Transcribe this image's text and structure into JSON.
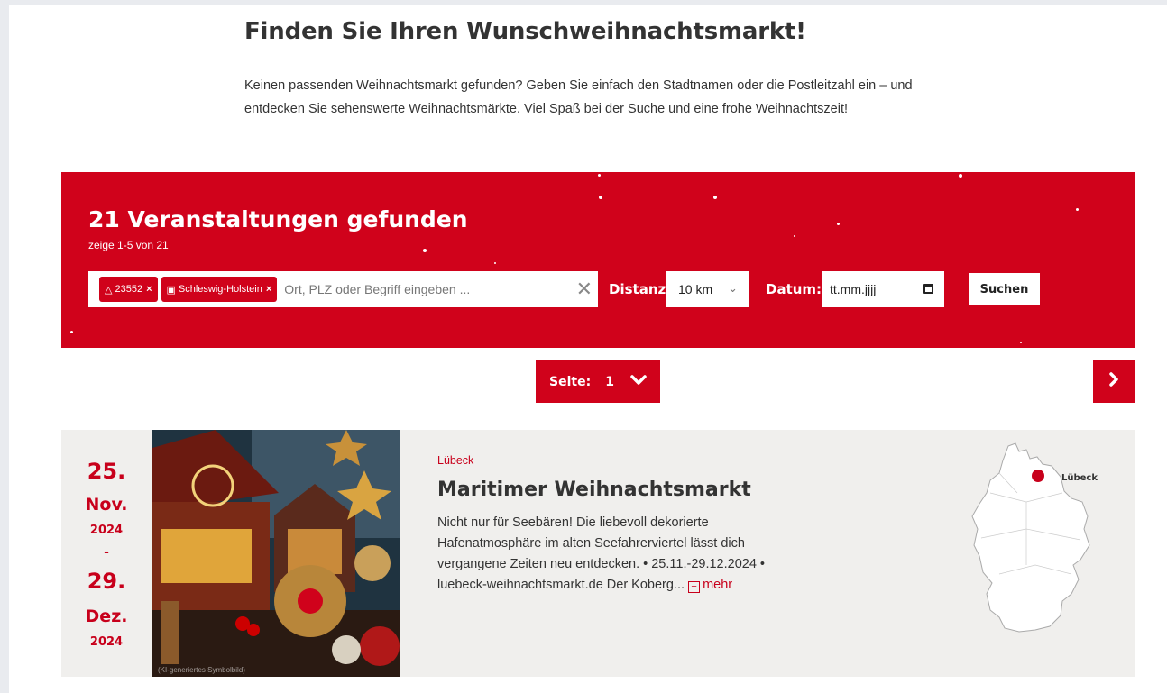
{
  "heading": "Finden Sie Ihren Wunschweihnachtsmarkt!",
  "intro": "Keinen passenden Weihnachtsmarkt gefunden? Geben Sie einfach den Stadtnamen oder die Postleitzahl ein – und entdecken Sie sehenswerte Weihnachtsmärkte. Viel Spaß bei der Suche und eine frohe Weihnachtszeit!",
  "banner": {
    "title": "21 Veranstaltungen gefunden",
    "subtitle": "zeige 1-5 von 21",
    "accent_color": "#d0021b"
  },
  "search": {
    "chips": [
      {
        "icon": "pin-icon",
        "label": "23552",
        "remove": "×"
      },
      {
        "icon": "map-icon",
        "label": "Schleswig-Holstein",
        "remove": "×"
      }
    ],
    "placeholder": "Ort, PLZ oder Begriff eingeben ...",
    "clear_symbol": "✕"
  },
  "filters": {
    "distance_label": "Distanz:",
    "distance_value": "10 km",
    "date_label": "Datum:",
    "date_value": "tt.mm.jjjj",
    "search_button": "Suchen"
  },
  "pagination": {
    "label": "Seite:",
    "current": "1"
  },
  "event": {
    "start_day": "25.",
    "start_month": "Nov.",
    "start_year": "2024",
    "separator": "-",
    "end_day": "29.",
    "end_month": "Dez.",
    "end_year": "2024",
    "image_credit": "(KI-generiertes Symbolbild)",
    "city": "Lübeck",
    "title": "Maritimer Weihnachtsmarkt",
    "description": "Nicht nur für Seebären! Die liebevoll dekorierte Hafenatmosphäre im alten Seefahrerviertel lässt dich vergangene Zeiten neu entdecken. • 25.11.-29.12.2024 • luebeck-weihnachtsmarkt.de Der Koberg...",
    "more_label": "mehr",
    "map_label": "Lübeck"
  }
}
